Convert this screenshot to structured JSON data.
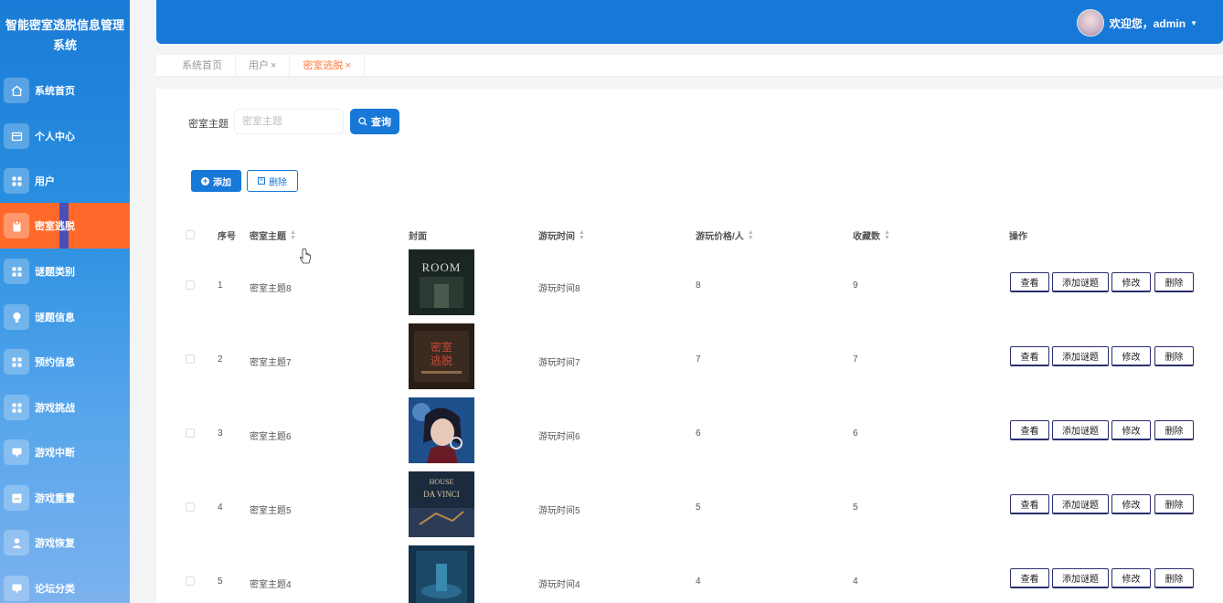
{
  "app": {
    "title": "智能密室逃脱信息管理系统"
  },
  "sidebar": {
    "items": [
      {
        "label": "系统首页",
        "icon": "home-icon"
      },
      {
        "label": "个人中心",
        "icon": "card-icon"
      },
      {
        "label": "用户",
        "icon": "grid-icon"
      },
      {
        "label": "密室逃脱",
        "icon": "clipboard-icon",
        "active": true
      },
      {
        "label": "谜题类别",
        "icon": "grid-icon"
      },
      {
        "label": "谜题信息",
        "icon": "bulb-icon"
      },
      {
        "label": "预约信息",
        "icon": "grid-icon"
      },
      {
        "label": "游戏挑战",
        "icon": "grid-icon"
      },
      {
        "label": "游戏中断",
        "icon": "chat-icon"
      },
      {
        "label": "游戏重置",
        "icon": "doc-icon"
      },
      {
        "label": "游戏恢复",
        "icon": "user-icon"
      },
      {
        "label": "论坛分类",
        "icon": "chat-icon"
      }
    ]
  },
  "header": {
    "welcome": "欢迎您，admin"
  },
  "tabs": [
    {
      "label": "系统首页",
      "closable": false
    },
    {
      "label": "用户",
      "closable": true
    },
    {
      "label": "密室逃脱",
      "closable": true,
      "active": true
    }
  ],
  "search": {
    "label": "密室主题",
    "placeholder": "密室主题",
    "value": "",
    "button": "查询"
  },
  "actions": {
    "add": "添加",
    "delete": "删除"
  },
  "table": {
    "columns": [
      "序号",
      "密室主题",
      "封面",
      "游玩时间",
      "游玩价格/人",
      "收藏数",
      "操作"
    ],
    "sortable": [
      false,
      true,
      false,
      true,
      true,
      true,
      false
    ],
    "operations": [
      "查看",
      "添加谜题",
      "修改",
      "删除"
    ],
    "rows": [
      {
        "index": "1",
        "theme": "密室主题8",
        "cover": "room",
        "cover_text": "ROOM",
        "play_time": "游玩时间8",
        "price": "8",
        "favorites": "9"
      },
      {
        "index": "2",
        "theme": "密室主题7",
        "cover": "escape",
        "cover_text": "密室逃脱",
        "play_time": "游玩时间7",
        "price": "7",
        "favorites": "7"
      },
      {
        "index": "3",
        "theme": "密室主题6",
        "cover": "girl",
        "cover_text": "",
        "play_time": "游玩时间6",
        "price": "6",
        "favorites": "6"
      },
      {
        "index": "4",
        "theme": "密室主题5",
        "cover": "house",
        "cover_text": "HOUSE DA VINCI",
        "play_time": "游玩时间5",
        "price": "5",
        "favorites": "5"
      },
      {
        "index": "5",
        "theme": "密室主题4",
        "cover": "hall",
        "cover_text": "",
        "play_time": "游玩时间4",
        "price": "4",
        "favorites": "4"
      }
    ]
  },
  "colors": {
    "primary": "#1778d8",
    "active_menu": "#ff6a2a",
    "active_tab": "#ff7a3d"
  }
}
